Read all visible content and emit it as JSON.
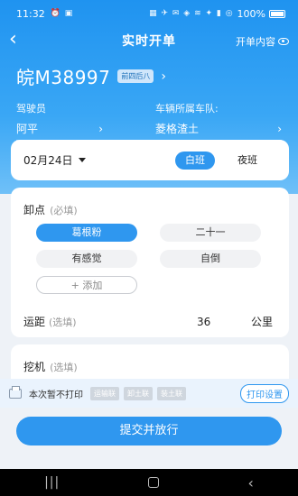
{
  "status_bar": {
    "time": "11:32",
    "left_icons": "⏰ ▣",
    "indicator_icons": "▦ ✈ ✉ ◈ ≋ ✦ ▮ ◎",
    "battery": "100%"
  },
  "topbar": {
    "back_glyph": "‹",
    "title": "实时开单",
    "open_content_label": "开单内容"
  },
  "vehicle": {
    "plate": "皖M38997",
    "tag": "前四后八",
    "arrow": "›"
  },
  "driver": {
    "label": "驾驶员",
    "value": "阿平",
    "arrow": "›"
  },
  "fleet": {
    "label": "车辆所属车队:",
    "value": "菱格渣土",
    "arrow": "›"
  },
  "shift": {
    "date": "02月24日",
    "day_label": "白班",
    "night_label": "夜班"
  },
  "unload": {
    "title": "卸点",
    "hint": "(必填)",
    "chips": [
      "葛根粉",
      "二十一",
      "有感觉",
      "自倒"
    ],
    "add_label": "+ 添加",
    "distance": {
      "label": "运距",
      "hint": "(选填)",
      "value": "36",
      "unit": "公里"
    }
  },
  "excavator": {
    "title": "挖机",
    "hint": "(选填)"
  },
  "print": {
    "label": "本次暂不打印",
    "tags": [
      "运输联",
      "卸土联",
      "装土联"
    ],
    "settings_label": "打印设置"
  },
  "submit_label": "提交并放行",
  "navbar": {
    "recent": "|||",
    "back": "‹"
  },
  "colors": {
    "primary": "#2f97ef",
    "header_top": "#1f93f0",
    "background": "#eef2f7"
  }
}
